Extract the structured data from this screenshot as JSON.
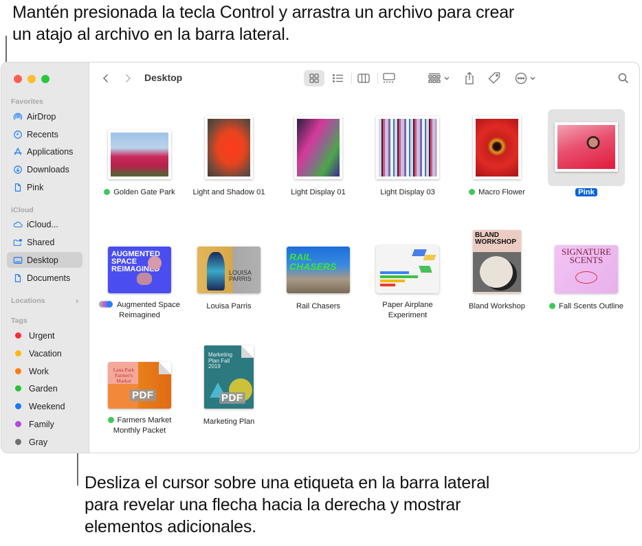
{
  "callouts": {
    "top": "Mantén presionada la tecla Control y arrastra un archivo para crear un atajo al archivo en la barra lateral.",
    "bottom": "Desliza el cursor sobre una etiqueta en la barra lateral para revelar una flecha hacia la derecha y mostrar elementos adicionales."
  },
  "window": {
    "title": "Desktop",
    "toolbar": {
      "back": "chevron-left-icon",
      "forward": "chevron-right-icon",
      "view_modes": [
        "icon-view",
        "list-view",
        "column-view",
        "gallery-view"
      ],
      "selected_view": "icon-view",
      "actions": [
        "group-by",
        "share",
        "tags",
        "more-actions",
        "search"
      ]
    }
  },
  "sidebar": {
    "favorites_label": "Favorites",
    "favorites": [
      {
        "label": "AirDrop",
        "icon": "airdrop-icon"
      },
      {
        "label": "Recents",
        "icon": "clock-icon"
      },
      {
        "label": "Applications",
        "icon": "applications-icon"
      },
      {
        "label": "Downloads",
        "icon": "download-icon"
      },
      {
        "label": "Pink",
        "icon": "document-icon"
      }
    ],
    "icloud_label": "iCloud",
    "icloud": [
      {
        "label": "iCloud...",
        "icon": "cloud-icon"
      },
      {
        "label": "Shared",
        "icon": "shared-folder-icon"
      },
      {
        "label": "Desktop",
        "icon": "desktop-icon",
        "active": true
      },
      {
        "label": "Documents",
        "icon": "document-icon"
      }
    ],
    "locations_label": "Locations",
    "tags_label": "Tags",
    "tags": [
      {
        "label": "Urgent",
        "color": "#fe2d3a"
      },
      {
        "label": "Vacation",
        "color": "#fdb70f"
      },
      {
        "label": "Work",
        "color": "#fe7d0f"
      },
      {
        "label": "Garden",
        "color": "#27c436"
      },
      {
        "label": "Weekend",
        "color": "#1a7bf5"
      },
      {
        "label": "Family",
        "color": "#b44ad9"
      },
      {
        "label": "Gray",
        "color": "#6f6f74"
      }
    ]
  },
  "files": [
    {
      "name": "Golden Gate Park",
      "tag": "#3ec959"
    },
    {
      "name": "Light and Shadow 01"
    },
    {
      "name": "Light Display 01"
    },
    {
      "name": "Light Display 03"
    },
    {
      "name": "Macro Flower",
      "tag": "#3ec959"
    },
    {
      "name": "Pink",
      "selected": true
    },
    {
      "name": "Augmented Space Reimagined",
      "tags": [
        "#a5a5a8",
        "#c25ae0",
        "#2d7ff5"
      ]
    },
    {
      "name": "Louisa Parris"
    },
    {
      "name": "Rail Chasers"
    },
    {
      "name": "Paper Airplane Experiment"
    },
    {
      "name": "Bland Workshop"
    },
    {
      "name": "Fall Scents Outline",
      "tag": "#3ec959"
    },
    {
      "name": "Farmers Market Monthly Packet",
      "tag": "#3ec959"
    },
    {
      "name": "Marketing Plan"
    }
  ],
  "thumb_text": {
    "augmented": "AUGMENTED SPACE REIMAGINED",
    "louisa": "LOUISA PARRIS",
    "rail": "RAIL CHASERS",
    "bland": "BLAND WORKSHOP",
    "scents": "SIGNATURE SCENTS",
    "farmers": "Lana Park Farmer's Market",
    "marketing": "Marketing Plan Fall 2019",
    "pdf": "PDF"
  },
  "colors": {
    "selection": "#0a63d6",
    "sidebar_bg": "#e8e8e8",
    "sidebar_icon": "#1a7bf5"
  }
}
